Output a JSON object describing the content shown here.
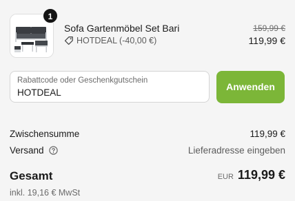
{
  "product": {
    "quantity": "1",
    "title": "Sofa Gartenmöbel Set Bari",
    "discount": "HOTDEAL (-40,00 €)",
    "price_old": "159,99 €",
    "price_new": "119,99 €"
  },
  "discount_code": {
    "label": "Rabattcode oder Geschenkgutschein",
    "value": "HOTDEAL",
    "apply_label": "Anwenden"
  },
  "summary": {
    "subtotal_label": "Zwischensumme",
    "subtotal_value": "119,99 €",
    "shipping_label": "Versand",
    "shipping_value": "Lieferadresse eingeben",
    "total_label": "Gesamt",
    "currency": "EUR",
    "total_value": "119,99 €",
    "tax_note": "inkl. 19,16 € MwSt"
  },
  "colors": {
    "apply_button": "#7cb638",
    "background": "#f5f5f5",
    "badge": "#141414"
  },
  "icons": [
    "tag-icon",
    "help-circle-icon",
    "product-thumbnail"
  ]
}
